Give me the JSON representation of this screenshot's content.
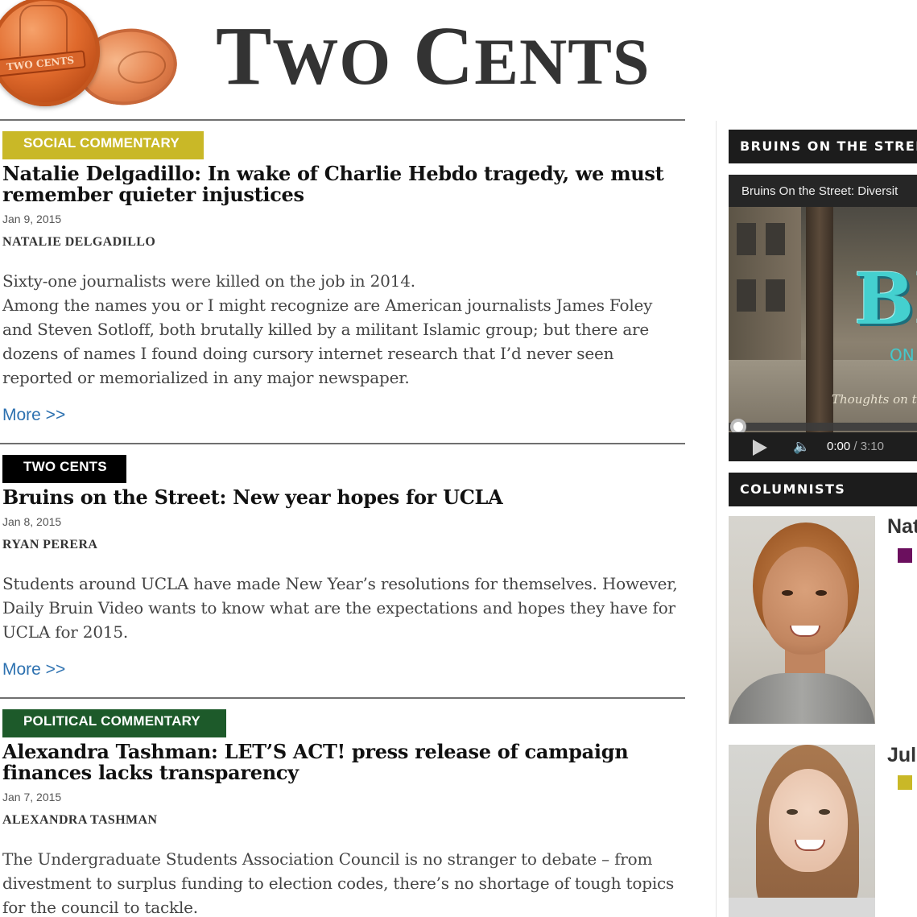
{
  "site": {
    "title_first": "T",
    "title_first_rest": "WO",
    "title_second": "C",
    "title_second_rest": "ENTS",
    "logo_text": "TWO CENTS"
  },
  "articles": [
    {
      "category": "SOCIAL COMMENTARY",
      "headline": "Natalie Delgadillo: In wake of Charlie Hebdo tragedy, we must remember quieter injustices",
      "date": "Jan 9, 2015",
      "byline": "NATALIE DELGADILLO",
      "excerpt_1": "Sixty-one journalists were killed on the job in 2014.",
      "excerpt_2": "Among the names you or I might recognize are American journalists James Foley and Steven Sotloff, both brutally killed by a militant Islamic group; but there are dozens of names I found doing cursory internet research that I’d never seen reported or memorialized in any major newspaper.",
      "more": "More >>"
    },
    {
      "category": "TWO CENTS",
      "headline": "Bruins on the Street: New year hopes for UCLA",
      "date": "Jan 8, 2015",
      "byline": "RYAN PERERA",
      "excerpt_1": "Students around UCLA have made New Year’s resolutions for themselves. However, Daily Bruin Video wants to know what are the expectations and hopes they have for UCLA for 2015.",
      "more": "More >>"
    },
    {
      "category": "POLITICAL COMMENTARY",
      "headline": "Alexandra Tashman: LET’S ACT! press release of campaign finances lacks transparency",
      "date": "Jan 7, 2015",
      "byline": "ALEXANDRA TASHMAN",
      "excerpt_1": "The Undergraduate Students Association Council is no stranger to debate – from divestment to surplus funding to election codes, there’s no shortage of tough topics for the council to tackle."
    }
  ],
  "colors": {
    "social": "#c9b827",
    "two_cents": "#000000",
    "political": "#1d5a2a",
    "link": "#2d71b0"
  },
  "sidebar": {
    "video_heading": "BRUINS ON THE STREE",
    "video": {
      "title": "Bruins On the Street: Diversit",
      "overlay_big": "BI",
      "overlay_on": "ON",
      "overlay_thoughts": "Thoughts on t",
      "time_current": "0:00",
      "time_sep": " / ",
      "time_duration": "3:10",
      "progress": 0,
      "play_icon": "play-icon",
      "volume_icon": "volume-icon"
    },
    "columnists_heading": "COLUMNISTS",
    "columnists": [
      {
        "name": "Nat",
        "color": "#6b0f5e"
      },
      {
        "name": "Jul",
        "color": "#c9b827"
      }
    ]
  }
}
